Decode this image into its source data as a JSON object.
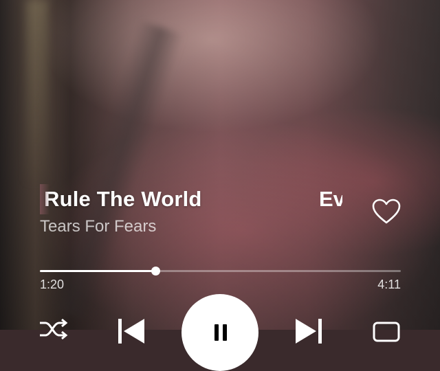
{
  "track": {
    "title": "Rule The World",
    "next_title_peek": "Ev",
    "artist": "Tears For Fears"
  },
  "playback": {
    "elapsed": "1:20",
    "total": "4:11",
    "progress_fraction": 0.32,
    "state": "playing"
  },
  "icons": {
    "like": "heart-outline-icon",
    "shuffle": "shuffle-icon",
    "previous": "skip-previous-icon",
    "pause": "pause-icon",
    "next": "skip-next-icon",
    "repeat": "repeat-icon"
  },
  "colors": {
    "primary_text": "#ffffff",
    "play_button_bg": "#ffffff"
  }
}
